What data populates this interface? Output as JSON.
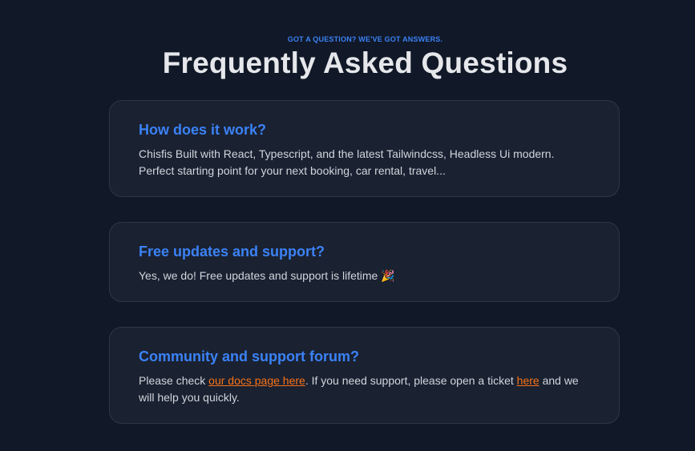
{
  "header": {
    "eyebrow": "GOT A QUESTION? WE'VE GOT ANSWERS.",
    "title": "Frequently Asked Questions"
  },
  "faqs": [
    {
      "question": "How does it work?",
      "answer": "Chisfis Built with React, Typescript, and the latest Tailwindcss, Headless Ui modern. Perfect starting point for your next booking, car rental, travel..."
    },
    {
      "question": "Free updates and support?",
      "answer": "Yes, we do! Free updates and support is lifetime",
      "emoji": "🎉"
    },
    {
      "question": "Community and support forum?",
      "answer_part1": "Please check ",
      "link1": "our docs page here",
      "answer_part2": ". If you need support, please open a ticket ",
      "link2": "here",
      "answer_part3": " and we will help you quickly."
    }
  ],
  "colors": {
    "background": "#111827",
    "card": "#1a2131",
    "accent": "#3b82f6",
    "link": "#f97316"
  }
}
